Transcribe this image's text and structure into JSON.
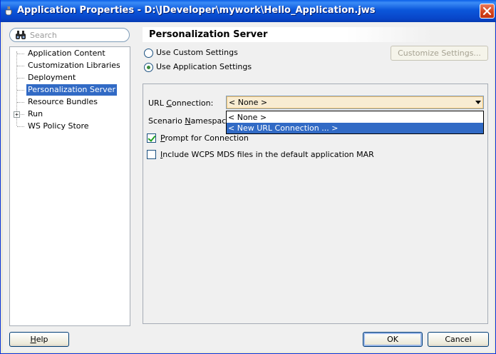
{
  "window": {
    "title": "Application Properties - D:\\JDeveloper\\mywork\\Hello_Application.jws"
  },
  "search": {
    "placeholder": "Search"
  },
  "tree": {
    "items": [
      {
        "label": "Application Content"
      },
      {
        "label": "Customization Libraries"
      },
      {
        "label": "Deployment"
      },
      {
        "label": "Personalization Server",
        "selected": true
      },
      {
        "label": "Resource Bundles"
      },
      {
        "label": "Run",
        "expandable": true
      },
      {
        "label": "WS Policy Store"
      }
    ]
  },
  "panel": {
    "title": "Personalization Server",
    "radio_custom_label": "Use Custom Settings",
    "radio_custom_mnemonic": "C",
    "radio_app_label": "Use Application Settings",
    "radio_app_mnemonic": "A",
    "selected_radio": "application",
    "customize_button_label": "Customize Settings...",
    "url_connection_label_pre": "URL ",
    "url_connection_mnemonic": "C",
    "url_connection_label_post": "onnection:",
    "url_connection_value": "< None >",
    "dropdown_options": [
      "< None >",
      "< New URL Connection ... >"
    ],
    "dropdown_highlighted_index": 1,
    "scenario_label_pre": "Scenario ",
    "scenario_mnemonic": "N",
    "scenario_label_post": "amespace:",
    "prompt_checkbox_mnemonic": "P",
    "prompt_checkbox_label_rest": "rompt for Connection",
    "prompt_checked": true,
    "include_checkbox_mnemonic": "I",
    "include_checkbox_label_rest": "nclude WCPS MDS files in the default application MAR",
    "include_checked": false
  },
  "footer": {
    "help_mnemonic": "H",
    "help_rest": "elp",
    "ok_label": "OK",
    "cancel_label": "Cancel"
  },
  "colors": {
    "titlebar": "#0a5fe8",
    "selection": "#316ac5",
    "combo_focus": "#f8ecd2"
  }
}
